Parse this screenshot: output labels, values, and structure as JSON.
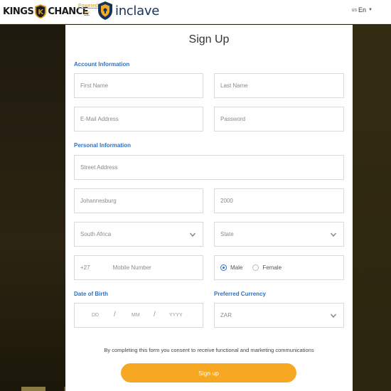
{
  "header": {
    "logo_left_1": "KINGS",
    "logo_left_2": "CHANCE",
    "crest_letter": "K",
    "powered_line1": "Powered",
    "powered_line2": "by",
    "inclave_text": "inclave",
    "lang_region": "us",
    "lang_label": "En"
  },
  "form": {
    "title": "Sign Up",
    "account_section": "Account Information",
    "first_name_placeholder": "First Name",
    "last_name_placeholder": "Last Name",
    "email_placeholder": "E-Mail Address",
    "password_placeholder": "Password",
    "personal_section": "Personal Information",
    "street_placeholder": "Street Address",
    "city_value": "Johannesburg",
    "postal_value": "2000",
    "country_value": "South Africa",
    "state_placeholder": "State",
    "phone_code": "+27",
    "mobile_placeholder": "Mobile Number",
    "gender_male": "Male",
    "gender_female": "Female",
    "gender_selected": "Male",
    "dob_label": "Date of Birth",
    "dob_dd": "DD",
    "dob_mm": "MM",
    "dob_yyyy": "YYYY",
    "dob_sep": "/",
    "currency_label": "Preferred Currency",
    "currency_value": "ZAR",
    "consent_text": "By completing this form you consent to receive functional and marketing communications",
    "submit_label": "Sign up"
  },
  "colors": {
    "accent_blue": "#2d71c4",
    "button_orange": "#f7a823",
    "inclave_navy": "#17335c",
    "powered_gold": "#d59b1f"
  }
}
